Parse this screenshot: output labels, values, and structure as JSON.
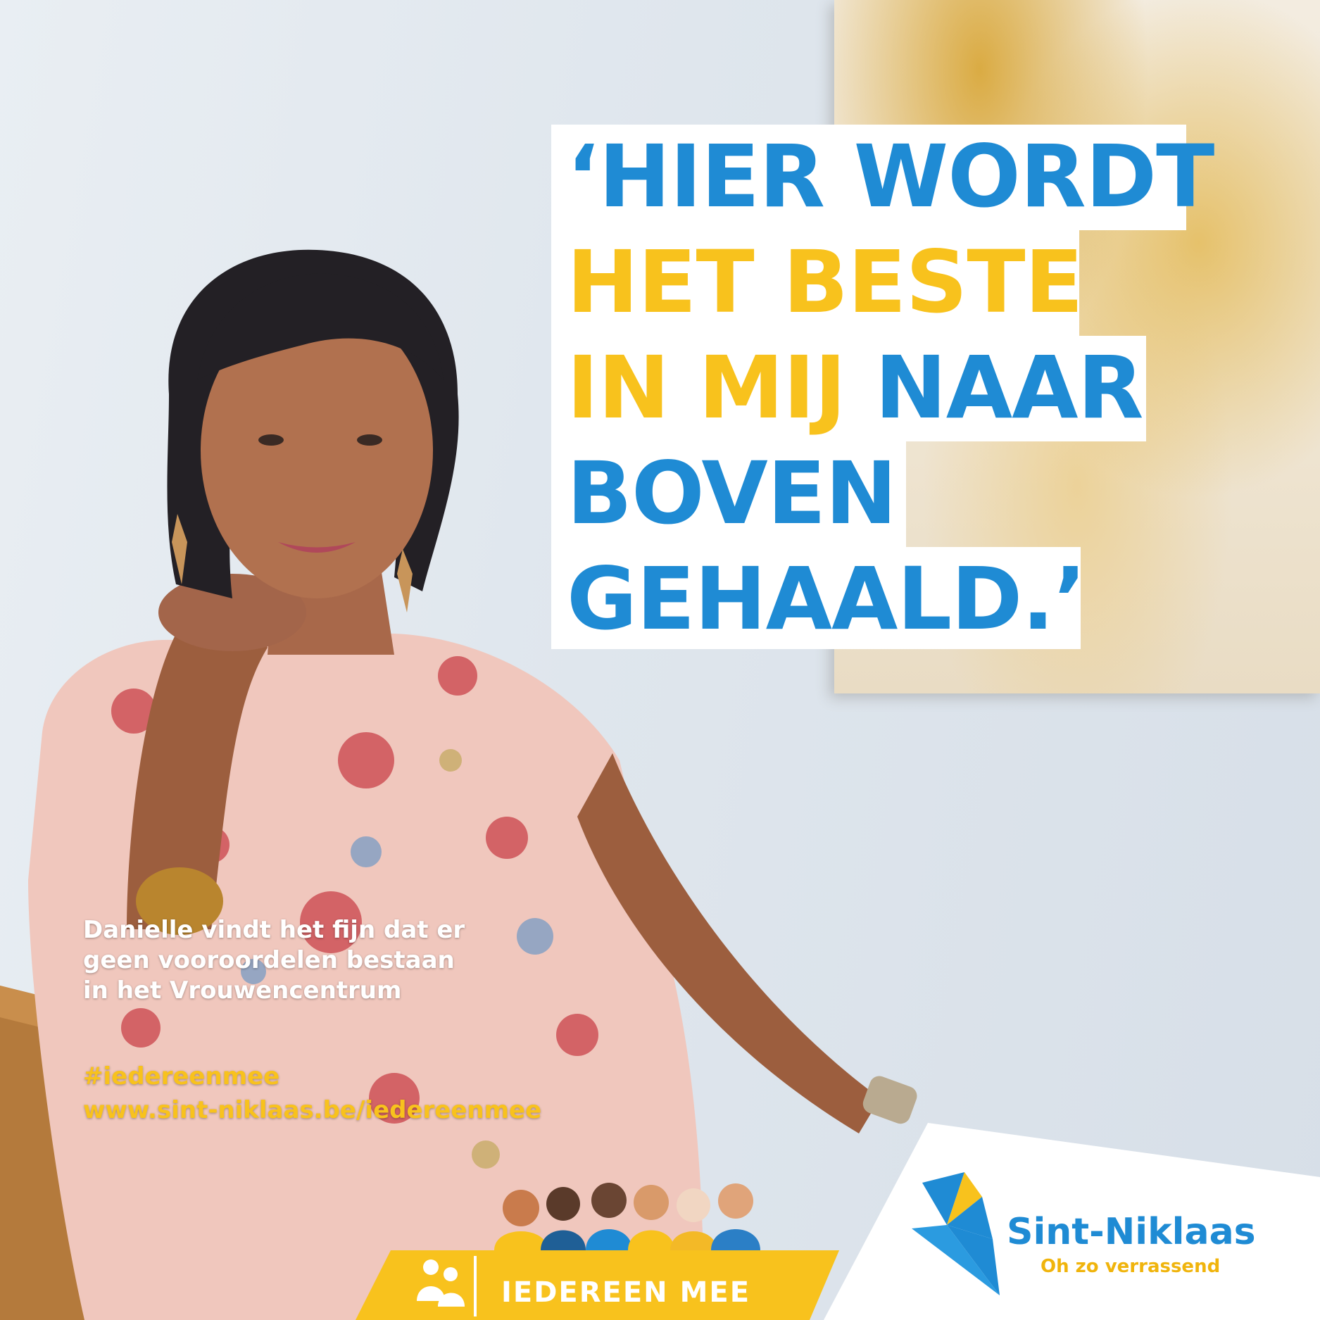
{
  "quote": {
    "lines": [
      [
        {
          "text": "‘HIER WORDT",
          "color": "blue"
        }
      ],
      [
        {
          "text": "HET BESTE",
          "color": "yellow"
        }
      ],
      [
        {
          "text": "IN MIJ ",
          "color": "yellow"
        },
        {
          "text": "NAAR",
          "color": "blue"
        }
      ],
      [
        {
          "text": "BOVEN",
          "color": "blue"
        }
      ],
      [
        {
          "text": "GEHAALD.’",
          "color": "blue"
        }
      ]
    ]
  },
  "caption": {
    "line1": "Danielle vindt het fijn dat er",
    "line2": "geen vooroordelen bestaan",
    "line3": "in het Vrouwencentrum"
  },
  "hashtag": "#iedereenmee",
  "url": "www.sint-niklaas.be/iedereenmee",
  "campaign": {
    "label": "IEDEREEN MEE",
    "icon": "people-icon"
  },
  "logo": {
    "name": "Sint-Niklaas",
    "slogan": "Oh zo verrassend",
    "icon": "kite-icon"
  },
  "colors": {
    "blue": "#1f8bd4",
    "yellow": "#f8c21d",
    "white": "#ffffff"
  }
}
